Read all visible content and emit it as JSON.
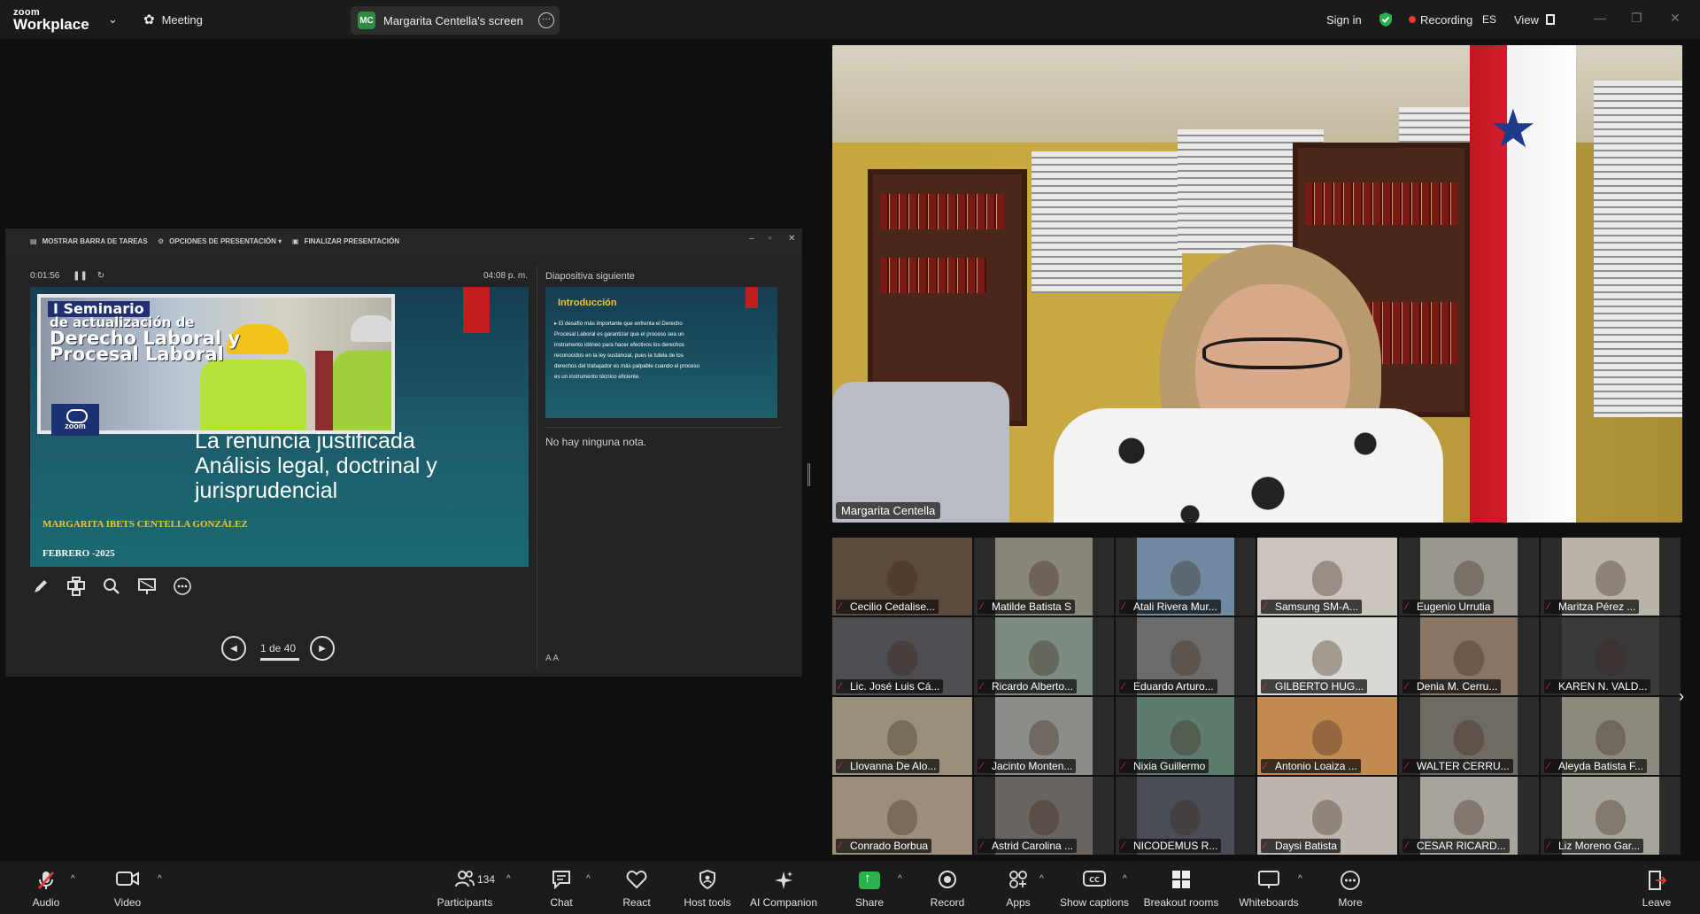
{
  "topbar": {
    "logo_small": "zoom",
    "logo_big": "Workplace",
    "meeting_label": "Meeting",
    "screen_badge": "MC",
    "screen_label": "Margarita Centella's screen",
    "sign_in": "Sign in",
    "recording": "Recording",
    "language": "ES",
    "view": "View",
    "colors": {
      "shield": "#2bb24c",
      "recording_dot": "#e53935"
    }
  },
  "presentation": {
    "toolbar": {
      "show_taskbar": "MOSTRAR BARRA DE TAREAS",
      "options": "OPCIONES DE PRESENTACIÓN ▾",
      "end": "FINALIZAR PRESENTACIÓN"
    },
    "timer": "0:01:56",
    "clock": "04:08 p. m.",
    "slide": {
      "banner1": "I Seminario",
      "banner2": "de actualización de",
      "banner3a": "Derecho Laboral y",
      "banner3b": "Procesal Laboral",
      "zoom_logo": "zoom",
      "heading1": "La renuncia justificada",
      "heading2": "Análisis legal, doctrinal y",
      "heading3": "jurisprudencial",
      "author": "MARGARITA IBETS CENTELLA GONZÁLEZ",
      "date": "FEBRERO -2025"
    },
    "next_label": "Diapositiva siguiente",
    "next_slide": {
      "title": "Introducción",
      "body": "▸ El desafío más importante que enfrenta el Derecho Procesal Laboral es garantizar que el proceso sea un instrumento idóneo para hacer efectivos los derechos reconocidos en la ley sustancial, pues la tutela de los derechos del trabajador es más palpable cuando el proceso es un instrumento técnico eficiente."
    },
    "notes": "No hay ninguna nota.",
    "page": "1 de 40",
    "font_controls": "A  A"
  },
  "speaker": {
    "name": "Margarita Centella"
  },
  "gallery": [
    {
      "name": "Cecilio Cedalise...",
      "bg": "#5c4a3a"
    },
    {
      "name": "Matilde Batista S",
      "bg": "#8a8579"
    },
    {
      "name": "Atali Rivera Mur...",
      "bg": "#6f8aa0"
    },
    {
      "name": "Samsung SM-A...",
      "bg": "#cbc4bd"
    },
    {
      "name": "Eugenio Urrutia",
      "bg": "#9a9790"
    },
    {
      "name": "Maritza Pérez ...",
      "bg": "#b9b3a8"
    },
    {
      "name": "Lic. José Luis Cá...",
      "bg": "#4d4d52"
    },
    {
      "name": "Ricardo Alberto...",
      "bg": "#7c8a80"
    },
    {
      "name": "Eduardo Arturo...",
      "bg": "#6e6c6a"
    },
    {
      "name": "GILBERTO HUG...",
      "bg": "#dad8d2"
    },
    {
      "name": "Denia M. Cerru...",
      "bg": "#8a7462"
    },
    {
      "name": "KAREN N. VALD...",
      "bg": "#3a3a3a"
    },
    {
      "name": "Llovanna De Alo...",
      "bg": "#9a8f7c"
    },
    {
      "name": "Jacinto Monten...",
      "bg": "#8b8d88"
    },
    {
      "name": "Nixia Guillermo",
      "bg": "#5d7c6d"
    },
    {
      "name": "Antonio Loaiza ...",
      "bg": "#c38a52"
    },
    {
      "name": "WALTER CERRU...",
      "bg": "#6f6a63"
    },
    {
      "name": "Aleyda Batista F...",
      "bg": "#8d8a7d"
    },
    {
      "name": "Conrado Borbua",
      "bg": "#9c8e7a"
    },
    {
      "name": "Astrid Carolina ...",
      "bg": "#6a6560"
    },
    {
      "name": "NICODEMUS R...",
      "bg": "#4a4d55"
    },
    {
      "name": "Daysi Batista",
      "bg": "#bdb6ae"
    },
    {
      "name": "CESAR RICARD...",
      "bg": "#a9a39d"
    },
    {
      "name": "Liz Moreno Gar...",
      "bg": "#a8a59c"
    }
  ],
  "bottombar": {
    "audio": "Audio",
    "video": "Video",
    "participants": "Participants",
    "participants_count": "134",
    "chat": "Chat",
    "react": "React",
    "host_tools": "Host tools",
    "ai_companion": "AI Companion",
    "share": "Share",
    "record": "Record",
    "apps": "Apps",
    "captions": "Show captions",
    "breakout": "Breakout rooms",
    "whiteboards": "Whiteboards",
    "more": "More",
    "leave": "Leave"
  }
}
